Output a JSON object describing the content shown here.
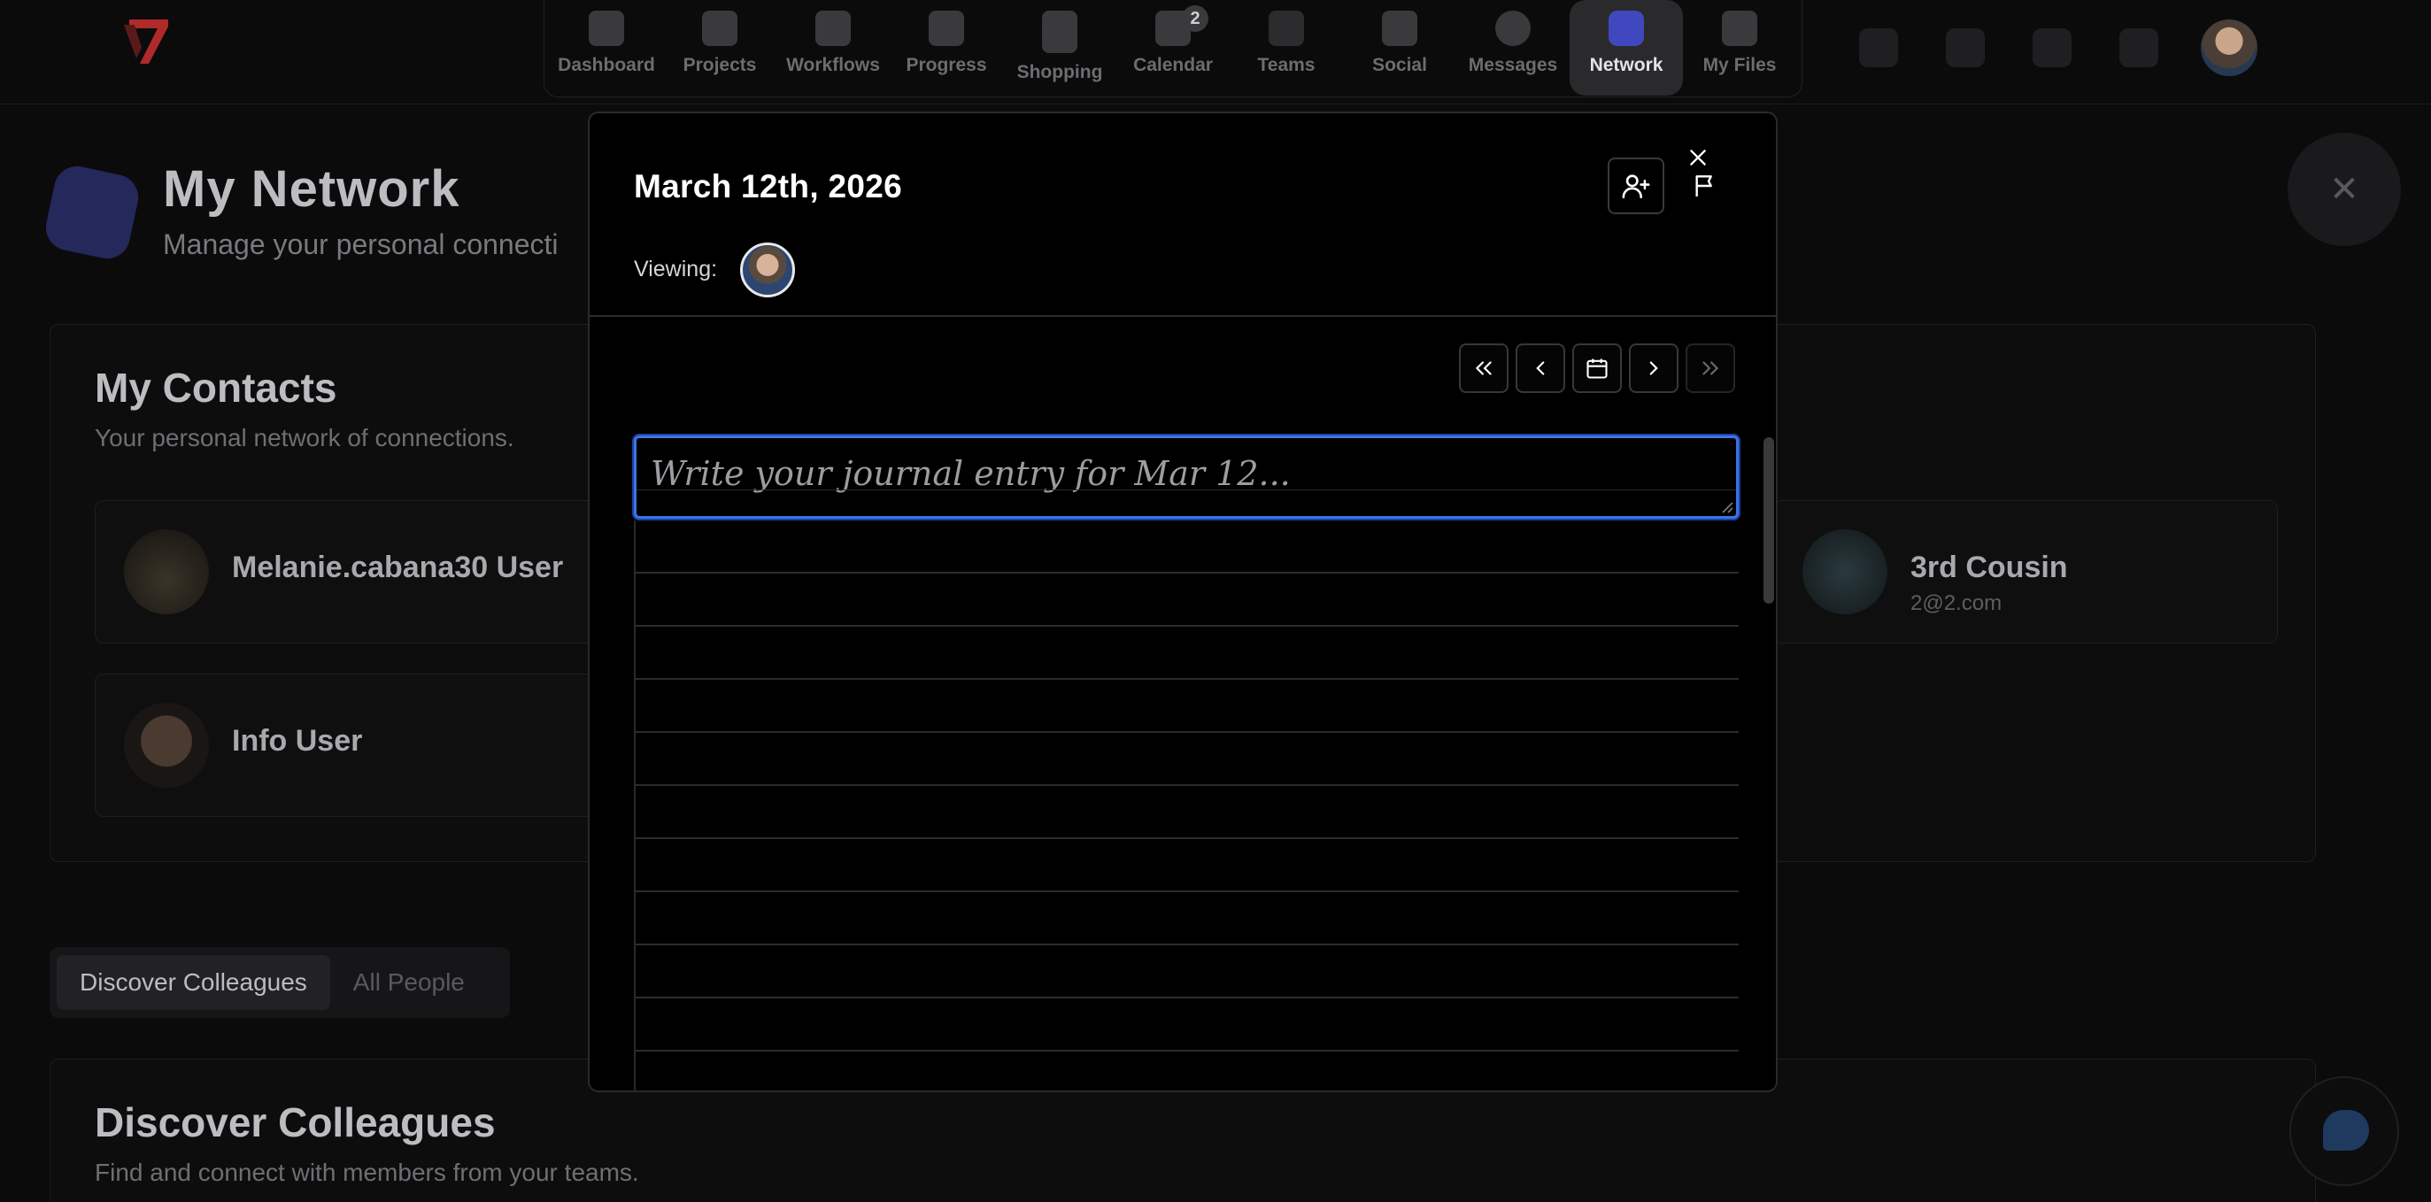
{
  "nav": {
    "items": [
      {
        "label": "Dashboard",
        "icon": "dashboard-icon"
      },
      {
        "label": "Projects",
        "icon": "projects-icon"
      },
      {
        "label": "Workflows",
        "icon": "workflows-icon"
      },
      {
        "label": "Progress",
        "icon": "progress-icon"
      },
      {
        "label": "Shopping",
        "icon": "shopping-cart-icon"
      },
      {
        "label": "Calendar",
        "icon": "calendar-icon",
        "badge": "2"
      },
      {
        "label": "Teams",
        "icon": "teams-icon"
      },
      {
        "label": "Social",
        "icon": "social-icon"
      },
      {
        "label": "Messages",
        "icon": "messages-icon"
      },
      {
        "label": "Network",
        "icon": "network-icon",
        "active": true
      },
      {
        "label": "My Files",
        "icon": "files-icon"
      }
    ]
  },
  "hero": {
    "title": "My Network",
    "subtitle": "Manage your personal connecti"
  },
  "contacts": {
    "title": "My Contacts",
    "subtitle": "Your personal network of connections.",
    "items": [
      {
        "name": "Melanie.cabana30 User",
        "email": ""
      },
      {
        "name": "3rd Cousin",
        "email": "2@2.com"
      },
      {
        "name": "Info User",
        "email": ""
      }
    ]
  },
  "tabs": {
    "discover": "Discover Colleagues",
    "all": "All People"
  },
  "discover": {
    "title": "Discover Colleagues",
    "subtitle": "Find and connect with members from your teams."
  },
  "modal": {
    "title": "March 12th, 2026",
    "viewing_label": "Viewing:",
    "journal_placeholder": "Write your journal entry for Mar 12..."
  },
  "colors": {
    "accent": "#3b74e6",
    "network_active": "#4a55ff",
    "logo_red": "#e03b3b"
  }
}
